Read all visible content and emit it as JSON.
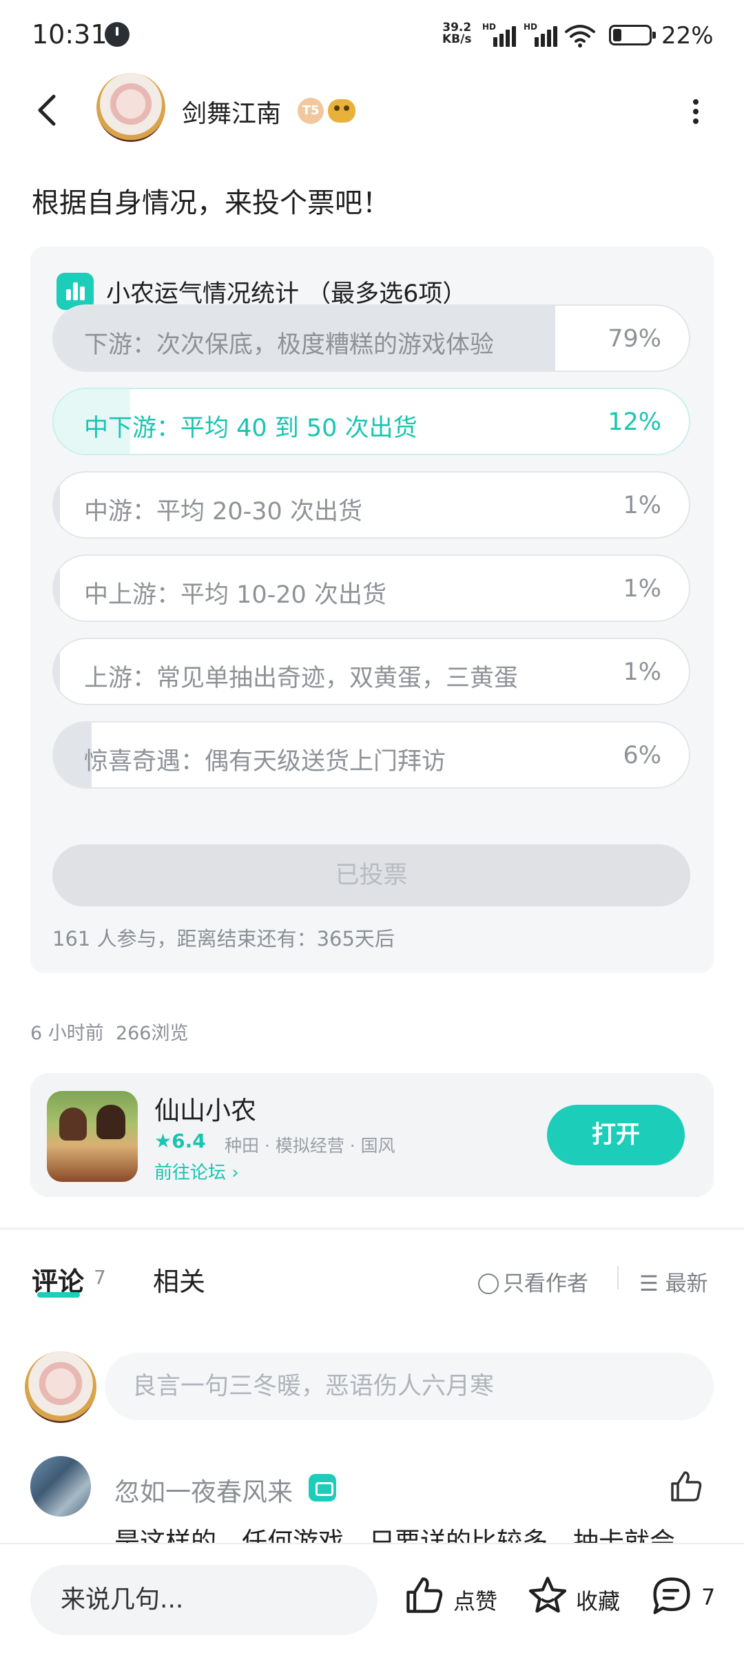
{
  "status_bar": {
    "time": "10:31",
    "net_speed_value": "39.2",
    "net_speed_unit": "KB/s",
    "signal_label": "HD",
    "battery": "22%"
  },
  "header": {
    "author": "剑舞江南",
    "badge_level": "T5"
  },
  "post": {
    "prompt": "根据自身情况，来投个票吧！"
  },
  "poll": {
    "title": "小农运气情况统计 （最多选6项）",
    "options": [
      {
        "label": "下游：次次保底，极度糟糕的游戏体验",
        "percent": "79%",
        "fraction": 0.79,
        "selected": false
      },
      {
        "label": "中下游：平均 40 到 50 次出货",
        "percent": "12%",
        "fraction": 0.12,
        "selected": true
      },
      {
        "label": "中游：平均 20-30 次出货",
        "percent": "1%",
        "fraction": 0.01,
        "selected": false
      },
      {
        "label": "中上游：平均 10-20 次出货",
        "percent": "1%",
        "fraction": 0.01,
        "selected": false
      },
      {
        "label": "上游：常见单抽出奇迹，双黄蛋，三黄蛋",
        "percent": "1%",
        "fraction": 0.01,
        "selected": false
      },
      {
        "label": "惊喜奇遇：偶有天级送货上门拜访",
        "percent": "6%",
        "fraction": 0.06,
        "selected": false
      }
    ],
    "voted_label": "已投票",
    "footer": "161 人参与，距离结束还有：365天后"
  },
  "meta": {
    "time_ago": "6 小时前",
    "views": "266浏览"
  },
  "game": {
    "name": "仙山小农",
    "rating": "6.4",
    "tags": "种田 · 模拟经营 · 国风",
    "forum_link": "前往论坛",
    "open_label": "打开"
  },
  "tabs": {
    "comments_label": "评论",
    "comments_count": "7",
    "related_label": "相关",
    "only_author": "只看作者",
    "sort_label": "最新"
  },
  "comment_input": {
    "placeholder": "良言一句三冬暖，恶语伤人六月寒"
  },
  "comment": {
    "username": "忽如一夜春风来",
    "text": "是这样的，任何游戏，只要详的比较多，抽卡就会"
  },
  "bottom_bar": {
    "say_placeholder": "来说几句...",
    "like_label": "点赞",
    "favorite_label": "收藏",
    "comment_count": "7"
  },
  "colors": {
    "accent": "#1ccdb9",
    "fill_grey": "#e1e4e8",
    "card_bg": "#f5f6f8"
  }
}
